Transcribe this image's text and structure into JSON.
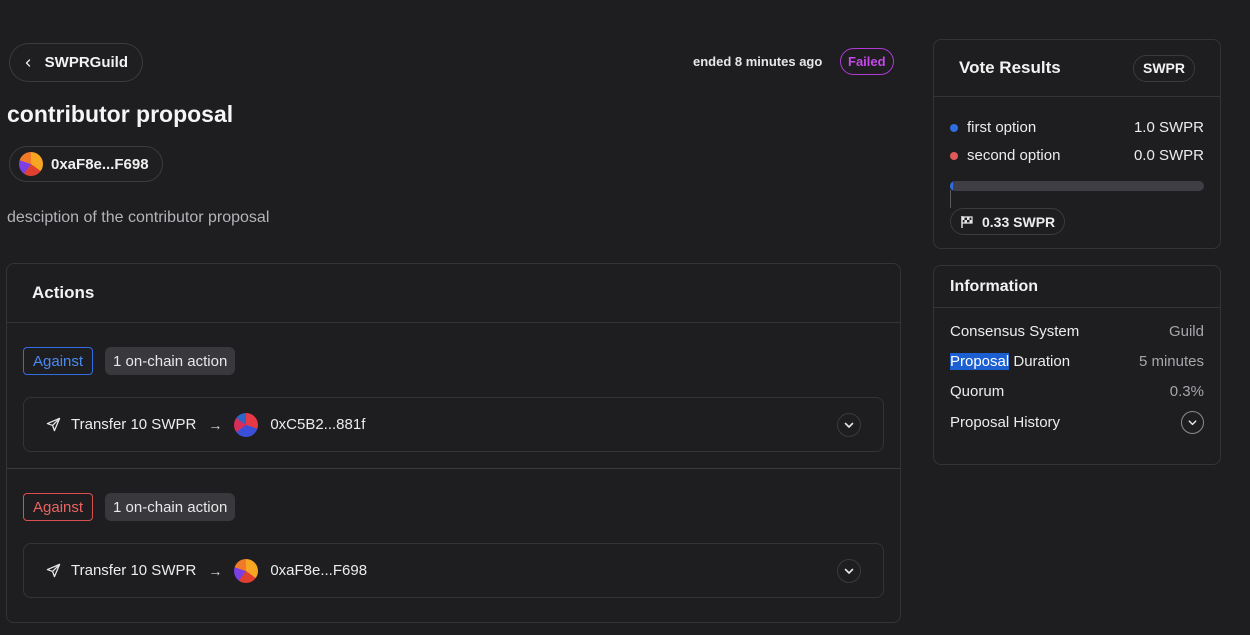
{
  "header": {
    "back_label": "SWPRGuild",
    "ended_text": "ended 8 minutes ago",
    "status": "Failed",
    "title": "contributor proposal",
    "author_address": "0xaF8e...F698",
    "description": "desciption of the contributor proposal"
  },
  "actions": {
    "title": "Actions",
    "options": [
      {
        "tag": "Against",
        "tag_color": "#2f6de0",
        "count": "1 on-chain action",
        "transfer": "Transfer 10 SWPR",
        "arrow": "→",
        "recipient": "0xC5B2...881f"
      },
      {
        "tag": "Against",
        "tag_color": "#d8504e",
        "count": "1 on-chain action",
        "transfer": "Transfer 10 SWPR",
        "arrow": "→",
        "recipient": "0xaF8e...F698"
      }
    ]
  },
  "vote_results": {
    "title": "Vote Results",
    "token": "SWPR",
    "options": [
      {
        "label": "first option",
        "value": "1.0 SWPR",
        "color": "#2f6de0"
      },
      {
        "label": "second option",
        "value": "0.0 SWPR",
        "color": "#e05a5a"
      }
    ],
    "progress_fraction": 0.01,
    "quorum": "0.33 SWPR"
  },
  "information": {
    "title": "Information",
    "rows": [
      {
        "label": "Consensus System",
        "value": "Guild"
      },
      {
        "label_highlight": "Proposal",
        "label_rest": " Duration",
        "value": "5 minutes"
      },
      {
        "label": "Quorum",
        "value": "0.3%"
      },
      {
        "label": "Proposal History"
      }
    ]
  }
}
